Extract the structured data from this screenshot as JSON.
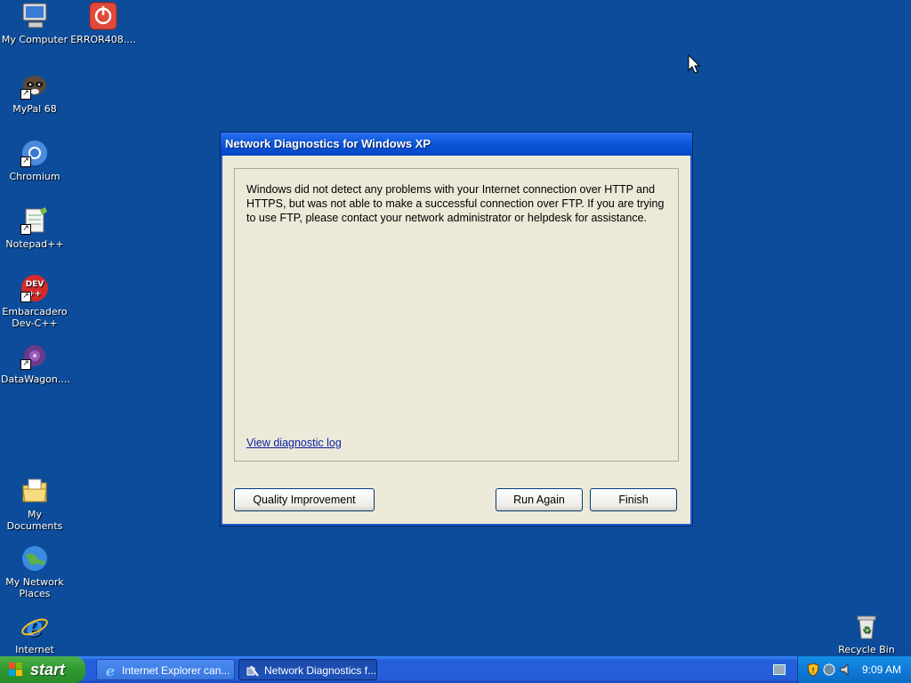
{
  "desktop": {
    "icons": [
      {
        "label": "My Computer"
      },
      {
        "label": "ERROR408...."
      },
      {
        "label": "MyPal 68"
      },
      {
        "label": "Chromium"
      },
      {
        "label": "Notepad++"
      },
      {
        "label": "Embarcadero Dev-C++"
      },
      {
        "label": "DataWagon...."
      },
      {
        "label": "My Documents"
      },
      {
        "label": "My Network Places"
      },
      {
        "label": "Internet"
      },
      {
        "label": "Recycle Bin"
      }
    ]
  },
  "dialog": {
    "title": "Network Diagnostics for Windows XP",
    "message": "Windows did not detect any problems with your Internet connection over HTTP and HTTPS, but was not able to make a successful connection over FTP. If you are trying to use FTP, please contact your network administrator or helpdesk for assistance.",
    "link": "View diagnostic log",
    "buttons": {
      "quality": "Quality Improvement",
      "run_again": "Run Again",
      "finish": "Finish"
    }
  },
  "taskbar": {
    "start_label": "start",
    "tasks": [
      {
        "label": "Internet Explorer can...",
        "icon": "ie-icon"
      },
      {
        "label": "Network Diagnostics f...",
        "icon": "network-diagnostics-icon"
      }
    ],
    "clock": "9:09 AM"
  },
  "colors": {
    "desktop_bg": "#0c4c9a",
    "titlebar": "#0a55d8",
    "start_green": "#2f9a2f"
  }
}
